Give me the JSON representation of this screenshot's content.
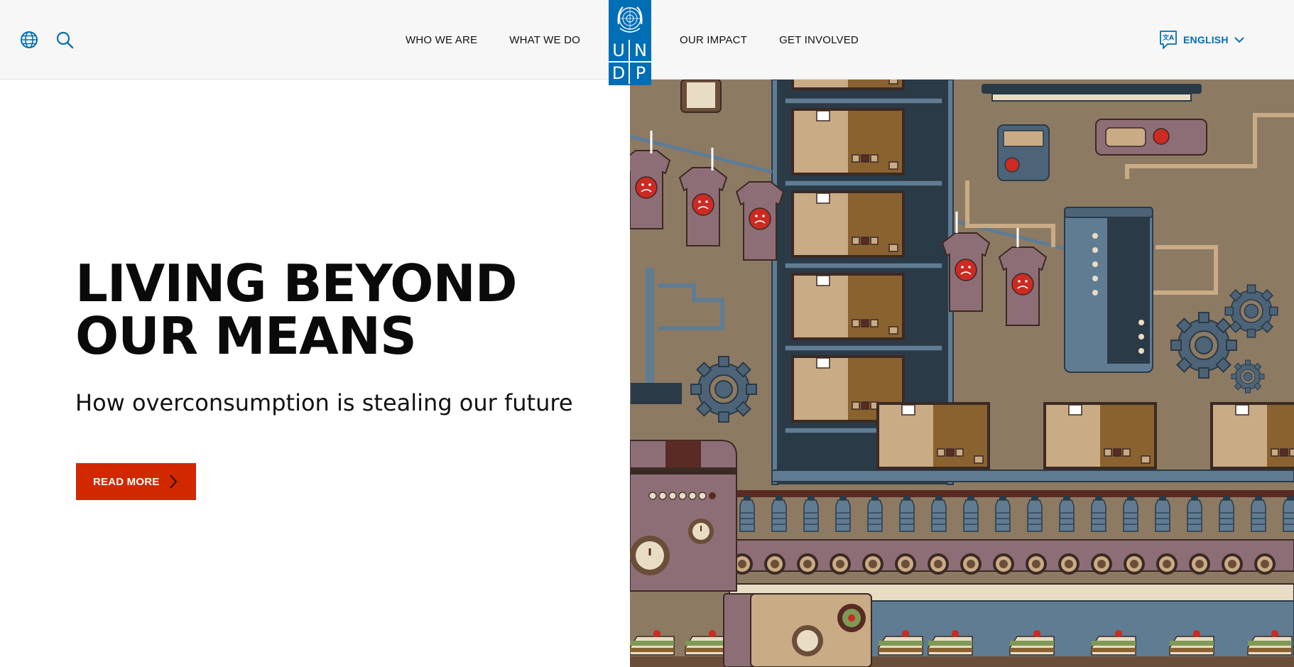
{
  "header": {
    "nav_left": [
      "WHO WE ARE",
      "WHAT WE DO"
    ],
    "nav_right": [
      "OUR IMPACT",
      "GET INVOLVED"
    ],
    "logo_letters": [
      "U",
      "N",
      "D",
      "P"
    ],
    "language": "ENGLISH"
  },
  "hero": {
    "title_line1": "LIVING BEYOND",
    "title_line2": "OUR MEANS",
    "subtitle": "How overconsumption is stealing our future",
    "cta_label": "READ MORE"
  },
  "colors": {
    "brand_blue": "#006eb5",
    "cta_red": "#d12800",
    "illustration_bg": "#8d7a63"
  },
  "icons": {
    "globe": "globe-icon",
    "search": "search-icon",
    "language": "translate-icon",
    "dropdown": "chevron-down-icon",
    "cta": "chevron-right-icon"
  }
}
